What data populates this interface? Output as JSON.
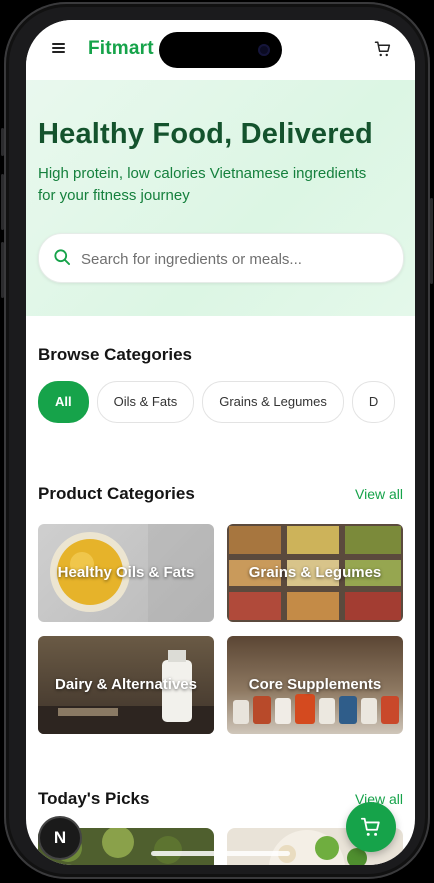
{
  "app": {
    "brand": "Fitmart"
  },
  "hero": {
    "title": "Healthy Food, Delivered",
    "subtitle": "High protein, low calories Vietnamese ingredients for your fitness journey",
    "search_placeholder": "Search for ingredients or meals..."
  },
  "browse": {
    "title": "Browse Categories",
    "chips": [
      {
        "label": "All",
        "active": true
      },
      {
        "label": "Oils & Fats",
        "active": false
      },
      {
        "label": "Grains & Legumes",
        "active": false
      },
      {
        "label": "D",
        "active": false
      }
    ]
  },
  "product_categories": {
    "title": "Product Categories",
    "view_all": "View all",
    "items": [
      {
        "label": "Healthy Oils & Fats"
      },
      {
        "label": "Grains & Legumes"
      },
      {
        "label": "Dairy & Alternatives"
      },
      {
        "label": "Core Supplements"
      }
    ]
  },
  "todays_picks": {
    "title": "Today's Picks",
    "view_all": "View all"
  },
  "floating": {
    "cart_icon": "shopping-cart-icon",
    "badge_letter": "N"
  },
  "colors": {
    "accent": "#16a34a",
    "hero_title": "#14532d",
    "hero_bg": "#e4f7ea"
  }
}
